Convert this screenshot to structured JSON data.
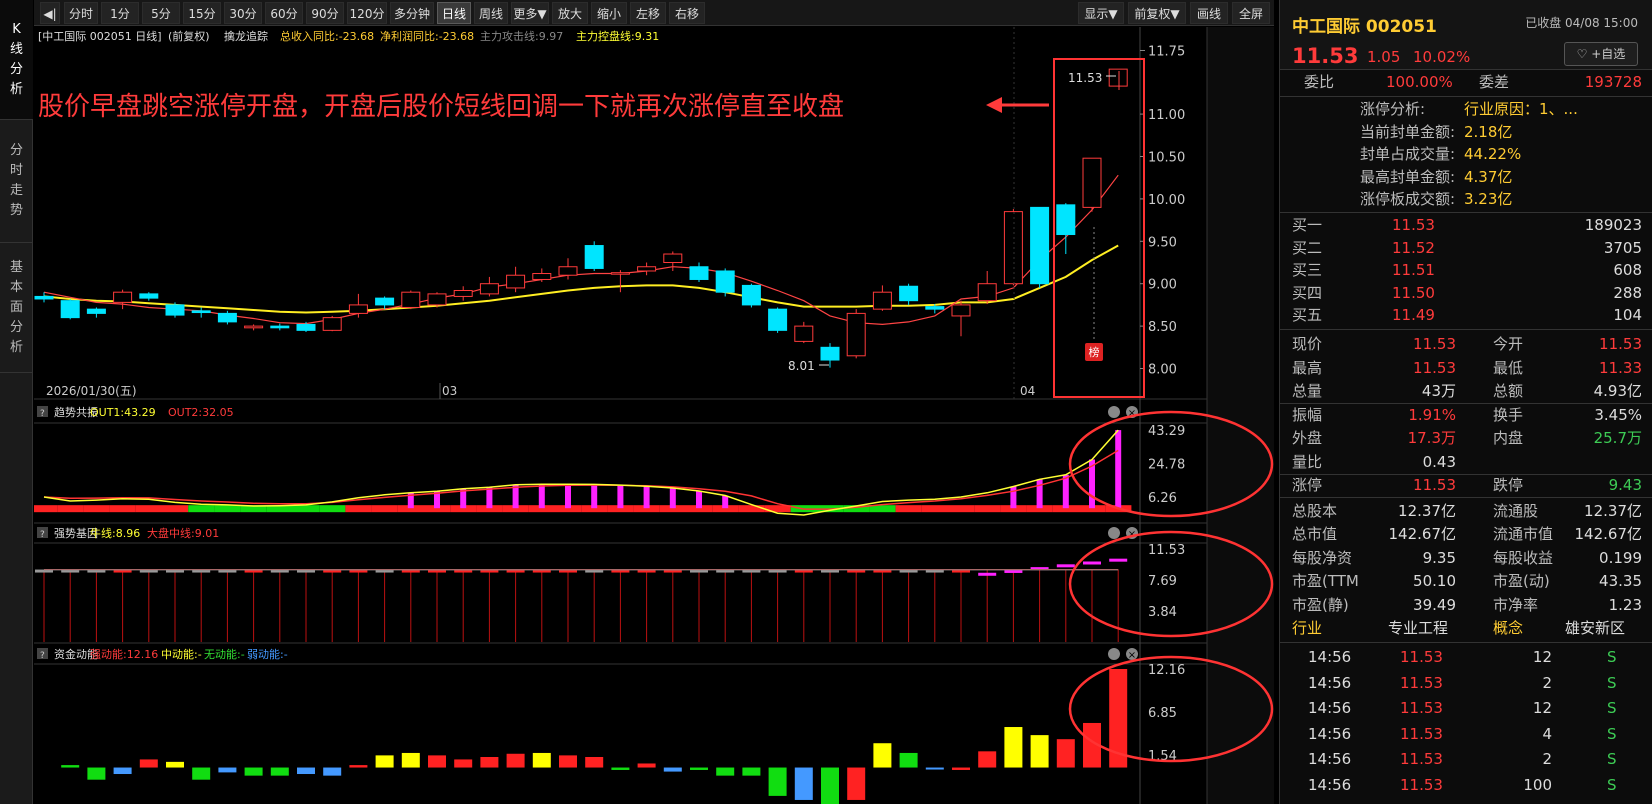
{
  "sidebar": {
    "tabs": [
      "K线分析",
      "分时走势",
      "基本面分析"
    ]
  },
  "toolbar": {
    "left": [
      "分时",
      "1分",
      "5分",
      "15分",
      "30分",
      "60分",
      "90分",
      "120分",
      "多分钟",
      "日线",
      "周线",
      "更多▼",
      "放大",
      "缩小",
      "左移",
      "右移"
    ],
    "active": "日线",
    "right": [
      "显示▼",
      "前复权▼",
      "画线",
      "全屏"
    ]
  },
  "main_chart": {
    "header": {
      "stock": "[中工国际 002051 日线]",
      "adjust": "(前复权)",
      "indicator": "擒龙追踪",
      "rev": "总收入同比:-23.68",
      "profit": "净利润同比:-23.68",
      "attack": "主力攻击线:9.97",
      "control": "主力控盘线:9.31"
    },
    "y_ticks": [
      "11.75",
      "11.00",
      "10.50",
      "10.00",
      "9.50",
      "9.00",
      "8.50",
      "8.00"
    ],
    "x_labels": [
      "2026/01/30(五)",
      "03",
      "04"
    ],
    "annotation": "股价早盘跳空涨停开盘，开盘后股价短线回调一下就再次涨停直至收盘",
    "high_label": "11.53",
    "low_label": "8.01",
    "badge": "榜"
  },
  "panel1": {
    "name": "趋势共振",
    "out1": "OUT1:43.29",
    "out2": "OUT2:32.05",
    "y_ticks": [
      "43.29",
      "24.78",
      "6.26"
    ]
  },
  "panel2": {
    "name": "强势基因",
    "bull": "牛线:8.96",
    "market": "大盘中线:9.01",
    "y_ticks": [
      "11.53",
      "7.69",
      "3.84"
    ]
  },
  "panel3": {
    "name": "资金动能",
    "strong": "强动能:12.16",
    "mid": "中动能:-",
    "none": "无动能:-",
    "weak": "弱动能:-",
    "y_ticks": [
      "12.16",
      "6.85",
      "1.54"
    ]
  },
  "chart_data": [
    {
      "type": "candlestick",
      "title": "中工国际 002051 日线",
      "x": [
        "2026/01/30",
        "03",
        "04"
      ],
      "y_range": [
        7.9,
        11.85
      ],
      "candles": [
        [
          8.85,
          8.82,
          8.9,
          8.78
        ],
        [
          8.8,
          8.6,
          8.82,
          8.58
        ],
        [
          8.7,
          8.65,
          8.72,
          8.6
        ],
        [
          8.78,
          8.9,
          8.93,
          8.7
        ],
        [
          8.88,
          8.83,
          8.9,
          8.8
        ],
        [
          8.75,
          8.63,
          8.78,
          8.6
        ],
        [
          8.68,
          8.66,
          8.72,
          8.6
        ],
        [
          8.65,
          8.55,
          8.68,
          8.52
        ],
        [
          8.48,
          8.5,
          8.52,
          8.45
        ],
        [
          8.5,
          8.48,
          8.53,
          8.45
        ],
        [
          8.52,
          8.45,
          8.55,
          8.43
        ],
        [
          8.45,
          8.6,
          8.62,
          8.44
        ],
        [
          8.65,
          8.75,
          8.88,
          8.6
        ],
        [
          8.83,
          8.75,
          8.85,
          8.7
        ],
        [
          8.72,
          8.9,
          8.92,
          8.7
        ],
        [
          8.75,
          8.88,
          8.9,
          8.72
        ],
        [
          8.85,
          8.92,
          8.97,
          8.8
        ],
        [
          8.88,
          9.0,
          9.08,
          8.85
        ],
        [
          8.95,
          9.1,
          9.2,
          8.9
        ],
        [
          9.05,
          9.12,
          9.18,
          9.02
        ],
        [
          9.1,
          9.2,
          9.3,
          9.05
        ],
        [
          9.45,
          9.18,
          9.5,
          9.15
        ],
        [
          9.12,
          9.13,
          9.16,
          8.9
        ],
        [
          9.15,
          9.2,
          9.25,
          9.1
        ],
        [
          9.25,
          9.35,
          9.38,
          9.15
        ],
        [
          9.2,
          9.05,
          9.25,
          9.02
        ],
        [
          9.15,
          8.9,
          9.18,
          8.85
        ],
        [
          8.98,
          8.75,
          9.0,
          8.72
        ],
        [
          8.7,
          8.45,
          8.72,
          8.42
        ],
        [
          8.32,
          8.5,
          8.55,
          8.3
        ],
        [
          8.25,
          8.1,
          8.3,
          8.01
        ],
        [
          8.15,
          8.65,
          8.7,
          8.12
        ],
        [
          8.7,
          8.9,
          8.98,
          8.68
        ],
        [
          8.97,
          8.8,
          9.0,
          8.75
        ],
        [
          8.73,
          8.7,
          8.76,
          8.65
        ],
        [
          8.62,
          8.75,
          8.8,
          8.38
        ],
        [
          8.8,
          9.0,
          9.15,
          8.76
        ],
        [
          9.0,
          9.85,
          9.88,
          8.98
        ],
        [
          9.9,
          9.0,
          9.9,
          8.95
        ],
        [
          9.93,
          9.58,
          9.95,
          9.35
        ],
        [
          9.9,
          10.48,
          10.48,
          9.85
        ],
        [
          11.33,
          11.53,
          11.53,
          11.33
        ]
      ],
      "ma5": [
        8.9,
        8.84,
        8.78,
        8.76,
        8.72,
        8.7,
        8.68,
        8.63,
        8.59,
        8.54,
        8.53,
        8.58,
        8.65,
        8.7,
        8.76,
        8.83,
        8.88,
        8.96,
        9.0,
        9.05,
        9.1,
        9.12,
        9.12,
        9.15,
        9.2,
        9.18,
        9.13,
        9.03,
        8.92,
        8.8,
        8.62,
        8.54,
        8.52,
        8.55,
        8.62,
        8.82,
        8.85,
        8.95,
        9.28,
        9.55,
        9.87,
        10.28
      ],
      "ma_yellow": [
        8.85,
        8.82,
        8.8,
        8.79,
        8.77,
        8.75,
        8.73,
        8.71,
        8.69,
        8.67,
        8.66,
        8.67,
        8.68,
        8.7,
        8.72,
        8.74,
        8.77,
        8.8,
        8.84,
        8.88,
        8.92,
        8.95,
        8.97,
        8.98,
        8.98,
        8.95,
        8.9,
        8.84,
        8.78,
        8.73,
        8.73,
        8.73,
        8.74,
        8.74,
        8.75,
        8.78,
        8.78,
        8.82,
        8.95,
        9.08,
        9.28,
        9.45
      ]
    },
    {
      "type": "line",
      "title": "趋势共振",
      "y_range": [
        0,
        45
      ],
      "series": [
        {
          "name": "OUT1",
          "values": [
            6.2,
            4,
            4.5,
            5.2,
            5,
            3.2,
            2.2,
            1.8,
            1.2,
            1.4,
            1.8,
            3.5,
            5.8,
            7.4,
            8.5,
            9.4,
            10.8,
            11.6,
            13,
            13.3,
            13.3,
            13.2,
            12.8,
            12.2,
            11.2,
            9.5,
            7,
            2,
            -2.8,
            -3.8,
            -1.2,
            1.2,
            3.7,
            4.5,
            5,
            6.2,
            8.5,
            12,
            16,
            18.5,
            27,
            43.29
          ]
        },
        {
          "name": "OUT2",
          "values": [
            6.2,
            5.5,
            5.6,
            5.8,
            5.7,
            4.8,
            4,
            3.4,
            2.7,
            2.4,
            2.4,
            3.2,
            4.7,
            6,
            7.2,
            8.3,
            9.6,
            10.6,
            11.6,
            12.3,
            12.7,
            12.8,
            12.7,
            12.4,
            11.8,
            10.8,
            9.4,
            6.8,
            2.5,
            -0.5,
            -0.5,
            0.5,
            2,
            3.1,
            4,
            5.2,
            7.1,
            9.4,
            12.7,
            16.6,
            23.4,
            32.05
          ]
        }
      ],
      "bar_colors": [
        "red",
        "red",
        "red",
        "red",
        "red",
        "red",
        "green",
        "green",
        "green",
        "green",
        "green",
        "green",
        "red",
        "red",
        "magenta",
        "magenta",
        "magenta",
        "magenta",
        "magenta",
        "magenta",
        "magenta",
        "magenta",
        "magenta",
        "magenta",
        "magenta",
        "magenta",
        "magenta",
        "red",
        "red",
        "green",
        "green",
        "green",
        "green",
        "red",
        "red",
        "red",
        "red",
        "magenta",
        "magenta",
        "magenta",
        "magenta",
        "magenta"
      ]
    },
    {
      "type": "bar",
      "title": "强势基因",
      "y_range": [
        0,
        11.8
      ],
      "series": [
        {
          "name": "牛线",
          "values": [
            8.96
          ]
        },
        {
          "name": "大盘中线",
          "values": [
            9.01
          ]
        }
      ]
    },
    {
      "type": "bar",
      "title": "资金动能",
      "y_range": [
        -4.5,
        12.16
      ],
      "values": [
        0.3,
        -1.5,
        -0.8,
        1.0,
        0.7,
        -1.5,
        -0.6,
        -1.0,
        -1.0,
        -0.8,
        -1.0,
        0.3,
        1.5,
        1.8,
        1.5,
        1.0,
        1.3,
        1.7,
        1.8,
        1.5,
        1.3,
        -0.3,
        0.5,
        -0.5,
        -0.3,
        -1.0,
        -1.0,
        -3.5,
        -4.0,
        -4.5,
        -4.0,
        3.0,
        1.8,
        -0.2,
        -0.3,
        2.0,
        5.0,
        4.0,
        3.5,
        5.5,
        12.16
      ],
      "colors": [
        "green",
        "green",
        "blue",
        "red",
        "yellow",
        "green",
        "blue",
        "green",
        "green",
        "blue",
        "blue",
        "red",
        "yellow",
        "yellow",
        "red",
        "red",
        "red",
        "red",
        "yellow",
        "red",
        "red",
        "green",
        "red",
        "blue",
        "green",
        "green",
        "green",
        "green",
        "blue",
        "green",
        "red",
        "yellow",
        "green",
        "blue",
        "red",
        "red",
        "yellow",
        "yellow",
        "red",
        "red"
      ]
    }
  ],
  "quote": {
    "title": "中工国际 002051",
    "status": "已收盘 04/08 15:00",
    "price": "11.53",
    "chg": "1.05",
    "pct": "10.02%",
    "fav": "♡ +自选",
    "weibi": {
      "label": "委比",
      "value": "100.00%",
      "label2": "委差",
      "value2": "193728"
    },
    "limit": [
      {
        "label": "涨停分析:",
        "value": "行业原因：1、..."
      },
      {
        "label": "当前封单金额:",
        "value": "2.18亿"
      },
      {
        "label": "封单占成交量:",
        "value": "44.22%"
      },
      {
        "label": "最高封单金额:",
        "value": "4.37亿"
      },
      {
        "label": "涨停板成交额:",
        "value": "3.23亿"
      }
    ],
    "bids": [
      {
        "label": "买一",
        "price": "11.53",
        "vol": "189023"
      },
      {
        "label": "买二",
        "price": "11.52",
        "vol": "3705"
      },
      {
        "label": "买三",
        "price": "11.51",
        "vol": "608"
      },
      {
        "label": "买四",
        "price": "11.50",
        "vol": "288"
      },
      {
        "label": "买五",
        "price": "11.49",
        "vol": "104"
      }
    ],
    "stats": [
      [
        {
          "l": "现价",
          "v": "11.53",
          "c": "red"
        },
        {
          "l": "今开",
          "v": "11.53",
          "c": "red"
        }
      ],
      [
        {
          "l": "最高",
          "v": "11.53",
          "c": "red"
        },
        {
          "l": "最低",
          "v": "11.33",
          "c": "red"
        }
      ],
      [
        {
          "l": "总量",
          "v": "43万",
          "c": "white"
        },
        {
          "l": "总额",
          "v": "4.93亿",
          "c": "white"
        }
      ],
      [
        {
          "l": "振幅",
          "v": "1.91%",
          "c": "red"
        },
        {
          "l": "换手",
          "v": "3.45%",
          "c": "white"
        }
      ],
      [
        {
          "l": "外盘",
          "v": "17.3万",
          "c": "red"
        },
        {
          "l": "内盘",
          "v": "25.7万",
          "c": "green"
        }
      ],
      [
        {
          "l": "量比",
          "v": "0.43",
          "c": "white"
        },
        {
          "l": "",
          "v": "",
          "c": "white"
        }
      ],
      [
        {
          "l": "涨停",
          "v": "11.53",
          "c": "red"
        },
        {
          "l": "跌停",
          "v": "9.43",
          "c": "green"
        }
      ],
      [
        {
          "l": "总股本",
          "v": "12.37亿",
          "c": "white"
        },
        {
          "l": "流通股",
          "v": "12.37亿",
          "c": "white"
        }
      ],
      [
        {
          "l": "总市值",
          "v": "142.67亿",
          "c": "white"
        },
        {
          "l": "流通市值",
          "v": "142.67亿",
          "c": "white"
        }
      ],
      [
        {
          "l": "每股净资",
          "v": "9.35",
          "c": "white"
        },
        {
          "l": "每股收益",
          "v": "0.199",
          "c": "white"
        }
      ],
      [
        {
          "l": "市盈(TTM",
          "v": "50.10",
          "c": "white"
        },
        {
          "l": "市盈(动)",
          "v": "43.35",
          "c": "white"
        }
      ],
      [
        {
          "l": "市盈(静)",
          "v": "39.49",
          "c": "white"
        },
        {
          "l": "市净率",
          "v": "1.23",
          "c": "white"
        }
      ]
    ],
    "industry": {
      "l1": "行业",
      "v1": "专业工程",
      "l2": "概念",
      "v2": "雄安新区"
    },
    "ticks": [
      {
        "t": "14:56",
        "p": "11.53",
        "v": "12",
        "s": "S"
      },
      {
        "t": "14:56",
        "p": "11.53",
        "v": "2",
        "s": "S"
      },
      {
        "t": "14:56",
        "p": "11.53",
        "v": "12",
        "s": "S"
      },
      {
        "t": "14:56",
        "p": "11.53",
        "v": "4",
        "s": "S"
      },
      {
        "t": "14:56",
        "p": "11.53",
        "v": "2",
        "s": "S"
      },
      {
        "t": "14:56",
        "p": "11.53",
        "v": "100",
        "s": "S"
      }
    ]
  }
}
